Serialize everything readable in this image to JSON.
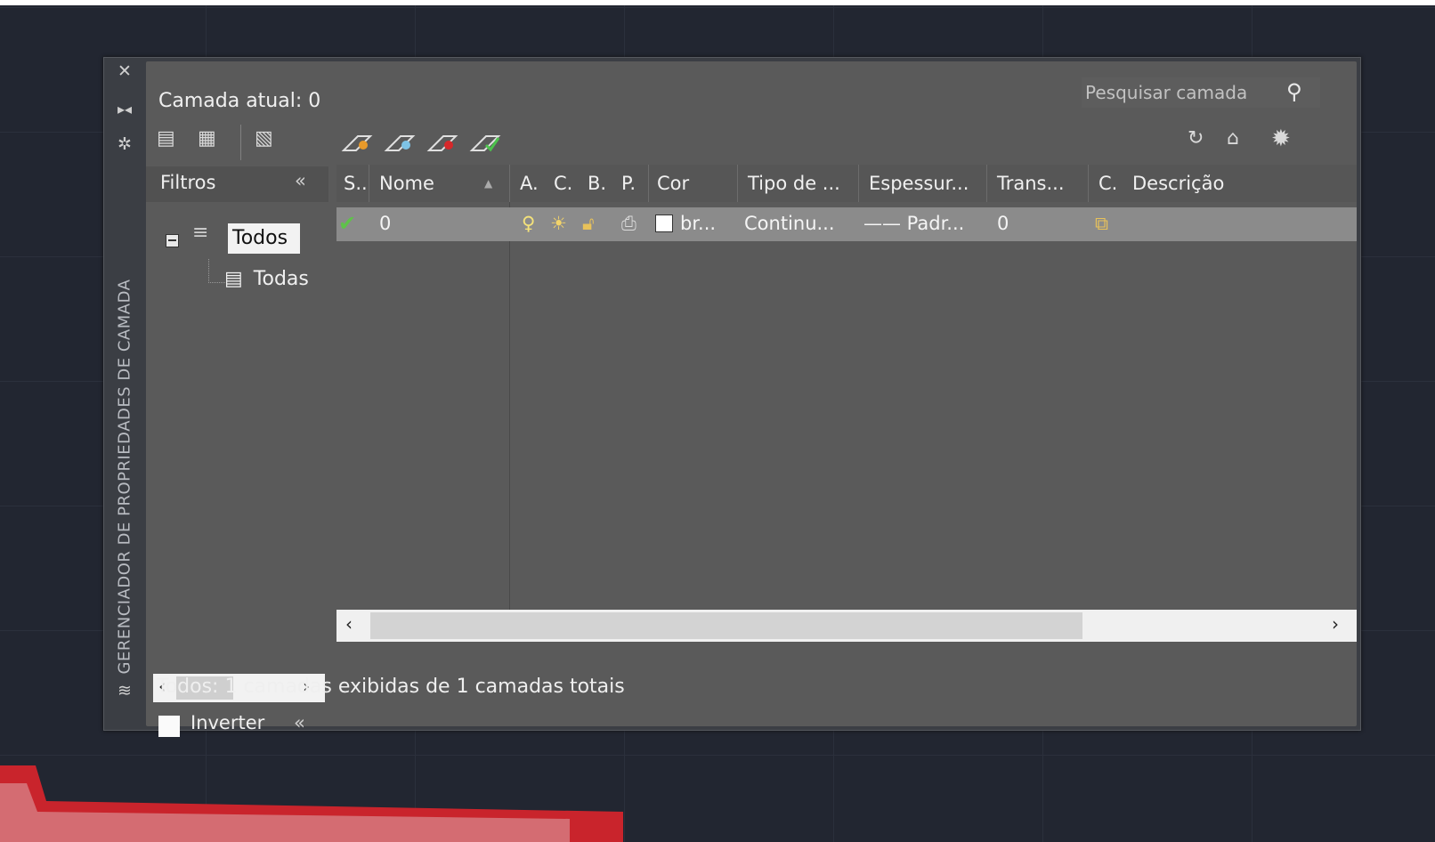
{
  "palette": {
    "vertical_title": "GERENCIADOR DE PROPRIEDADES DE CAMADA",
    "current_layer": "Camada atual: 0",
    "search_placeholder": "Pesquisar camada"
  },
  "filters": {
    "header": "Filtros",
    "tree": [
      {
        "label": "Todos"
      },
      {
        "label": "Todas"
      }
    ],
    "invert_label": "Inverter"
  },
  "table": {
    "columns": [
      "S..",
      "Nome",
      "A.",
      "C.",
      "B.",
      "P.",
      "Cor",
      "Tipo de ...",
      "Espessur...",
      "Trans...",
      "C.",
      "Descrição"
    ],
    "rows": [
      {
        "name": "0",
        "color": "br...",
        "linetype": "Continu...",
        "lineweight": "—— Padr...",
        "transparency": "0"
      }
    ]
  },
  "status": "Todos: 1 camadas exibidas de 1 camadas totais",
  "colors": {
    "background": "#222631",
    "panel": "#5a5a5a",
    "selected_row": "#8b8b8b",
    "accent_red": "#c9242c"
  }
}
